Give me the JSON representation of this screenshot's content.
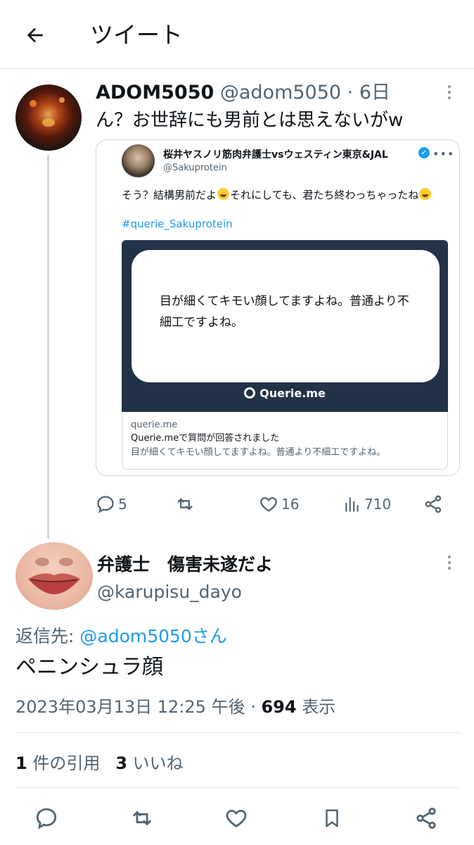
{
  "header": {
    "title": "ツイート"
  },
  "tweet1": {
    "display_name": "ADOM5050",
    "handle_meta": " @adom5050 · 6日",
    "text": "ん？お世辞にも男前とは思えないがw",
    "actions": {
      "reply_count": "5",
      "like_count": "16",
      "views_count": "710"
    }
  },
  "quote": {
    "display_name": "桜井ヤスノリ筋肉弁護士vsウェスティン東京&JAL",
    "handle": "@Sakuprotein",
    "text_part1": "そう？結構男前だよ",
    "text_part2": "それにしても、君たち終わっちゃったね",
    "hashtag": "#querie_Sakuprotein",
    "media_text": "目が細くてキモい顔してますよね。普通より不細工ですよね。",
    "media_brand": "Querie.me",
    "link_domain": "querie.me",
    "link_title": "Querie.meで質問が回答されました",
    "link_desc": "目が細くてキモい顔してますよね。普通より不細工ですよね。"
  },
  "tweet2": {
    "display_name": "弁護士　傷害未遂だよ",
    "handle": "@karupisu_dayo",
    "reply_prefix": "返信先: ",
    "reply_target": "@adom5050さん",
    "text": "ペニンシュラ顔",
    "timestamp": "2023年03月13日 12:25 午後 · ",
    "views": "694",
    "views_label": " 表示",
    "quote_count": "1",
    "quote_label": " 件の引用",
    "like_count": "3",
    "like_label": " いいね"
  },
  "colors": {
    "accent": "#1d9bf0",
    "secondary_text": "#536471",
    "primary_text": "#0f1419",
    "border": "#cfd9de"
  },
  "icons": {
    "back": "arrow-left-icon",
    "reply": "reply-icon",
    "retweet": "retweet-icon",
    "like": "heart-icon",
    "views": "analytics-icon",
    "share": "share-icon",
    "bookmark": "bookmark-icon",
    "more": "more-icon"
  }
}
